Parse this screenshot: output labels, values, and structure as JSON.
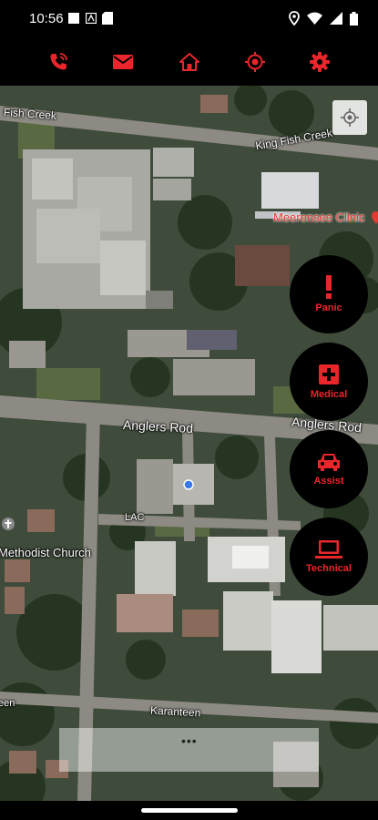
{
  "status_bar": {
    "time": "10:56",
    "left_icons": [
      "square-notification-icon",
      "app-notification-icon",
      "sd-card-icon"
    ],
    "right_icons": [
      "location-icon",
      "wifi-icon",
      "signal-icon",
      "battery-icon"
    ]
  },
  "toolbar": {
    "accent_color": "#e8262b",
    "items": [
      {
        "icon": "phone-call-icon"
      },
      {
        "icon": "mail-icon"
      },
      {
        "icon": "home-icon"
      },
      {
        "icon": "crosshair-icon"
      },
      {
        "icon": "gear-icon"
      }
    ]
  },
  "map": {
    "labels": {
      "fish_creek_left": "Fish Creek",
      "king_fish_creek": "King Fish Creek",
      "clinic": "Meerensee Clinic",
      "anglers_rod_left": "Anglers Rod",
      "anglers_rod_right": "Anglers Rod",
      "lac": "LAC",
      "methodist_church": "Methodist Church",
      "karanteen": "Karanteen",
      "een": "een",
      "dots": "•••"
    }
  },
  "actions": [
    {
      "label": "Panic",
      "icon": "exclamation-icon"
    },
    {
      "label": "Medical",
      "icon": "medical-cross-icon"
    },
    {
      "label": "Assist",
      "icon": "car-icon"
    },
    {
      "label": "Technical",
      "icon": "laptop-icon"
    }
  ]
}
